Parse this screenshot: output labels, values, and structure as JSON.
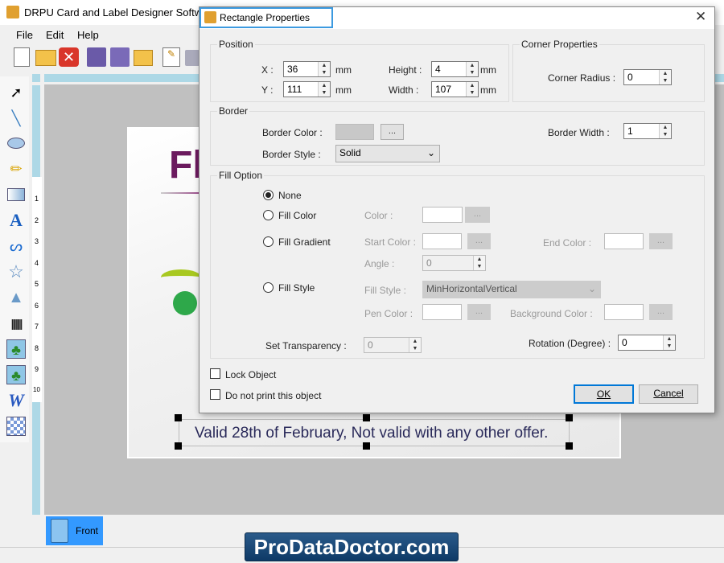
{
  "app": {
    "title": "DRPU Card and Label Designer Software",
    "menu": [
      {
        "label": "File"
      },
      {
        "label": "Edit"
      },
      {
        "label": "Help"
      }
    ],
    "ruler_numbers": [
      "1",
      "2",
      "3",
      "4",
      "5",
      "6",
      "7",
      "8",
      "9",
      "10"
    ],
    "card": {
      "headline": "Fl",
      "footer_text": "Valid 28th of February, Not valid with any other offer."
    },
    "tabs": [
      {
        "label": "Front"
      }
    ],
    "watermark": "ProDataDoctor.com",
    "colors": {
      "accent": "#3399ff",
      "ruler": "#add8e6",
      "canvas": "#c0c0c0",
      "headline": "#6b1a5e"
    }
  },
  "dialog": {
    "title": "Rectangle Properties",
    "position": {
      "label": "Position",
      "x_label": "X :",
      "x": "36",
      "y_label": "Y :",
      "y": "111",
      "height_label": "Height :",
      "height": "4",
      "width_label": "Width :",
      "width": "107",
      "unit": "mm"
    },
    "corner": {
      "label": "Corner Properties",
      "radius_label": "Corner Radius :",
      "radius": "0"
    },
    "border": {
      "label": "Border",
      "color_label": "Border Color :",
      "browse": "...",
      "width_label": "Border Width :",
      "width": "1",
      "style_label": "Border Style :",
      "style": "Solid"
    },
    "fill": {
      "label": "Fill Option",
      "none": "None",
      "fill_color": "Fill Color",
      "fill_gradient": "Fill Gradient",
      "fill_style": "Fill Style",
      "selected": "None",
      "color_label": "Color :",
      "start_color_label": "Start Color :",
      "end_color_label": "End Color :",
      "angle_label": "Angle :",
      "angle": "0",
      "fill_style_label": "Fill Style :",
      "fill_style_value": "MinHorizontalVertical",
      "pen_color_label": "Pen Color :",
      "background_color_label": "Background Color :",
      "transparency_label": "Set Transparency :",
      "transparency": "0",
      "rotation_label": "Rotation (Degree) :",
      "rotation": "0"
    },
    "lock_object": "Lock Object",
    "no_print": "Do not print this object",
    "ok": "OK",
    "cancel": "Cancel"
  }
}
